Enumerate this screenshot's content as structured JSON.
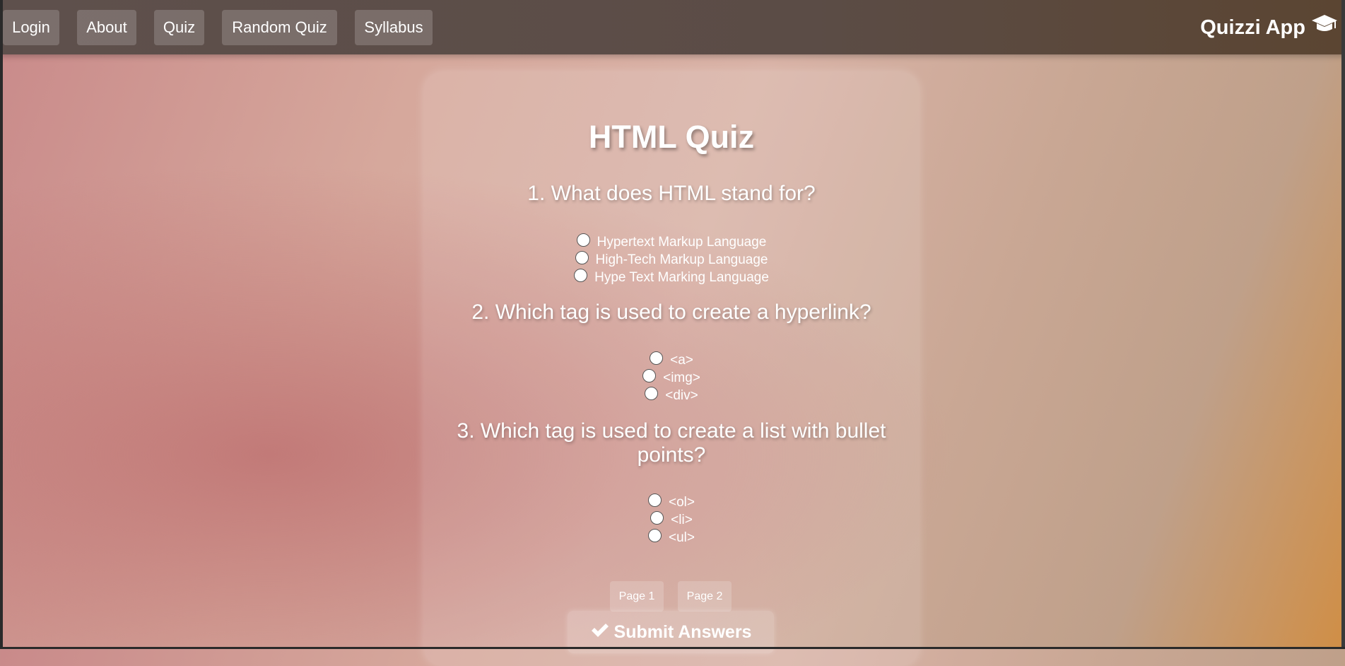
{
  "nav": {
    "items": [
      {
        "label": "Login"
      },
      {
        "label": "About"
      },
      {
        "label": "Quiz"
      },
      {
        "label": "Random Quiz"
      },
      {
        "label": "Syllabus"
      }
    ],
    "brand": "Quizzi App",
    "brand_icon": "graduation-cap-icon"
  },
  "quiz": {
    "title": "HTML Quiz",
    "questions": [
      {
        "text": "1. What does HTML stand for?",
        "options": [
          "Hypertext Markup Language",
          "High-Tech Markup Language",
          "Hype Text Marking Language"
        ]
      },
      {
        "text": "2. Which tag is used to create a hyperlink?",
        "options": [
          "<a>",
          "<img>",
          "<div>"
        ]
      },
      {
        "text": "3. Which tag is used to create a list with bullet points?",
        "options": [
          "<ol>",
          "<li>",
          "<ul>"
        ]
      }
    ],
    "pages": [
      "Page 1",
      "Page 2"
    ],
    "submit_label": "Submit Answers",
    "submit_icon": "check-icon"
  }
}
